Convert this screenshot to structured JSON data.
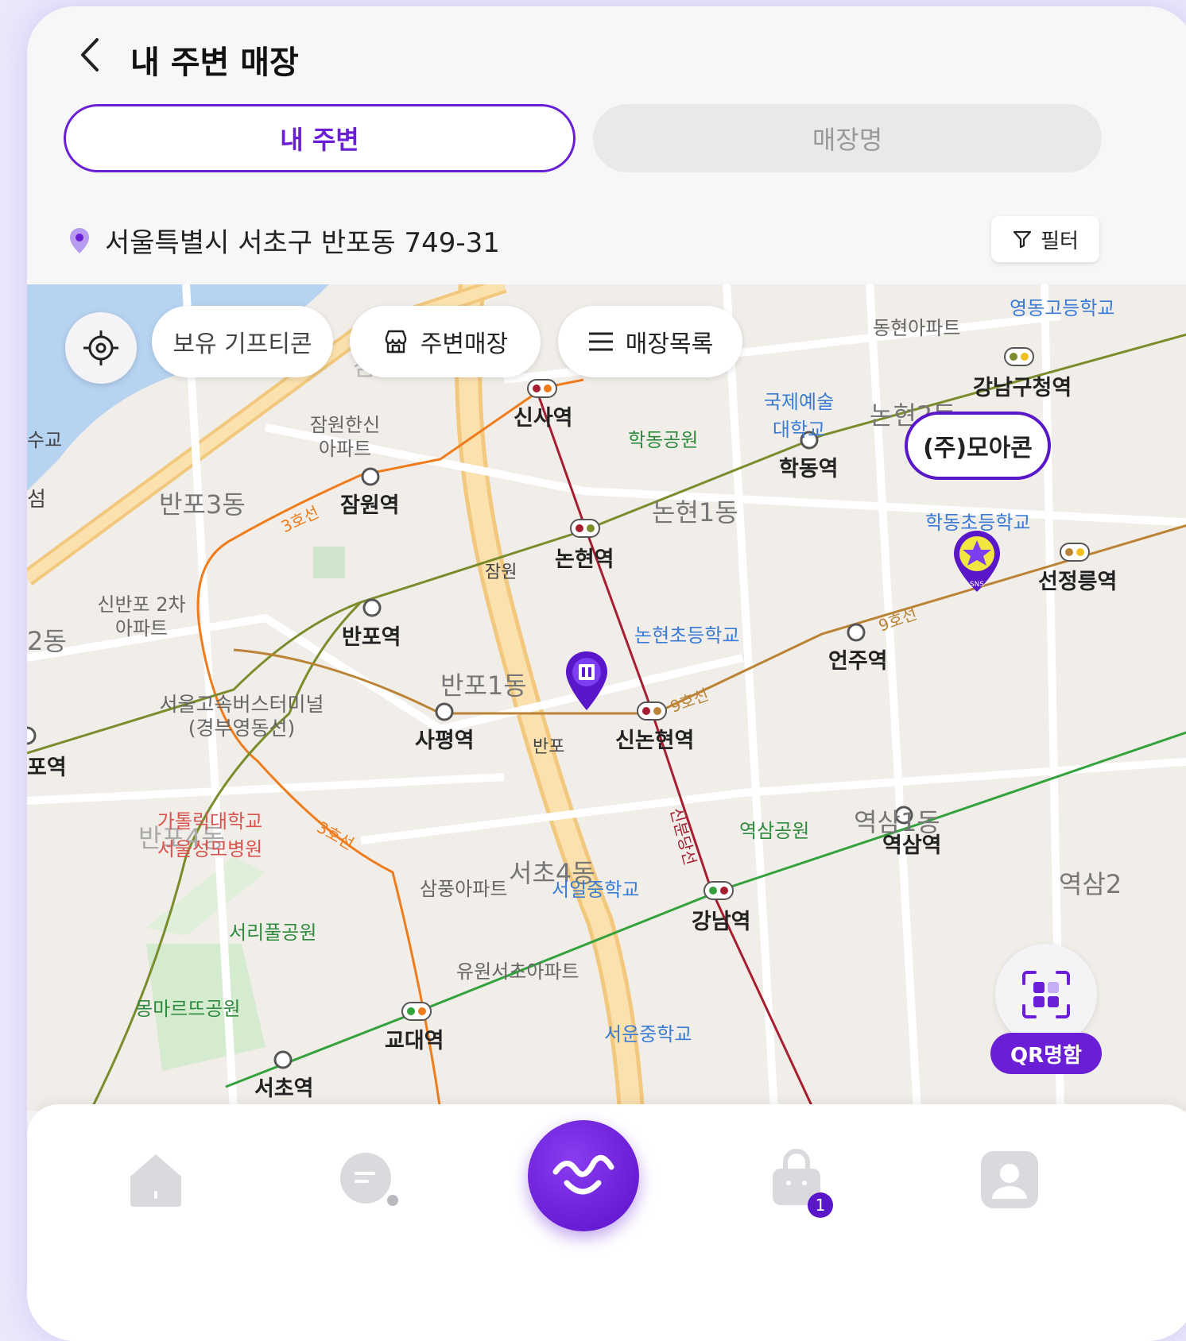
{
  "header": {
    "title": "내 주변 매장",
    "back_icon": "chevron-left-icon"
  },
  "tabs": [
    {
      "label": "내 주변",
      "active": true
    },
    {
      "label": "매장명",
      "active": false
    }
  ],
  "location": {
    "address": "서울특별시 서초구 반포동 749-31",
    "icon": "location-pin-icon"
  },
  "filter": {
    "label": "필터",
    "icon": "filter-icon"
  },
  "map_controls": {
    "locate_icon": "crosshair-icon",
    "chips": [
      {
        "label": "보유 기프티콘"
      },
      {
        "label": "주변매장",
        "icon": "store-icon"
      },
      {
        "label": "매장목록",
        "icon": "list-icon"
      }
    ]
  },
  "map": {
    "stations": [
      "신사역",
      "잠원역",
      "논현역",
      "반포역",
      "사평역",
      "신논현역",
      "학동역",
      "강남구청역",
      "선정릉역",
      "언주역",
      "역삼역",
      "강남역",
      "교대역",
      "서초역",
      "포역"
    ],
    "districts": [
      "반포3동",
      "논현1동",
      "반포1동",
      "서초4동",
      "역삼1동",
      "역삼2",
      "2동",
      "논현2동",
      "잠원동",
      "반포4동"
    ],
    "pois": [
      "잠원한신 아파트",
      "신반포 2차아파트",
      "서울고속버스터미널 (경부영동선)",
      "삼풍아파트",
      "유원서초아파트",
      "동현아파트"
    ],
    "parks": [
      "학동공원",
      "역삼공원",
      "서리풀공원",
      "몽마르뜨공원"
    ],
    "schools": [
      "국제예술 대학교",
      "논현초등학교",
      "서일중학교",
      "서운중학교",
      "학동초등학교",
      "영동고등학교"
    ],
    "hospitals": [
      "가톨릭대학교 서울성모병원"
    ],
    "misc": [
      "수교",
      "섬",
      "잠원",
      "반포"
    ],
    "line_labels": [
      "3호선",
      "3호선",
      "9호선",
      "9호선",
      "신분당선"
    ],
    "store_callout": "(주)모아콘",
    "store_marker_label": "SNS"
  },
  "qr": {
    "label": "QR명함",
    "icon": "qr-grid-icon"
  },
  "bottom_nav": {
    "items": [
      {
        "icon": "home-icon"
      },
      {
        "icon": "chat-icon"
      },
      {
        "icon": "moacon-logo-icon"
      },
      {
        "icon": "shopping-bag-icon",
        "badge": "1"
      },
      {
        "icon": "profile-icon"
      }
    ]
  },
  "colors": {
    "accent": "#6a1fd6",
    "line3": "#ef7c1c",
    "line9": "#bb8336",
    "line2": "#33a23d",
    "sinbundang": "#a71e31"
  }
}
